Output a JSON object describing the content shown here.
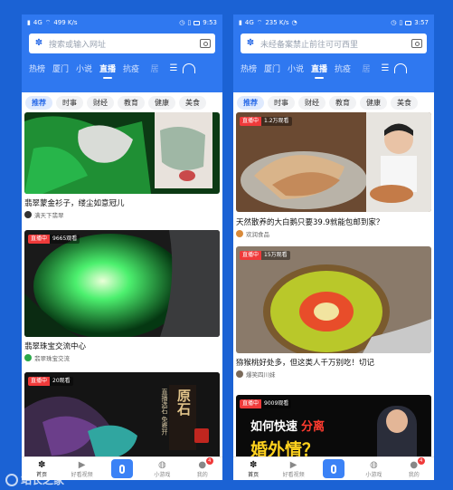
{
  "left": {
    "status": {
      "signal": "4G",
      "speed": "499 K/s",
      "time": "9:53"
    },
    "search_placeholder": "搜索或输入网址",
    "tabs": [
      "热榜",
      "厦门",
      "小说",
      "直播",
      "抗疫",
      "居"
    ],
    "subtabs": [
      "推荐",
      "时事",
      "财经",
      "教育",
      "健康",
      "美食"
    ],
    "cards": [
      {
        "title": "翡翠蒙金衫子，缕尘如意冠儿",
        "author": "满天下翡翠"
      },
      {
        "badge": "直播中",
        "viewers": "9665观看",
        "title": "翡翠珠宝交流中心",
        "author": "翡翠珠宝交流"
      },
      {
        "badge": "直播中",
        "viewers": "20观看",
        "poster_text": "原石",
        "poster_sub": "直播选石 免费开"
      }
    ],
    "nav": [
      "首页",
      "好看视频",
      "",
      "小游戏",
      "我的"
    ],
    "nav_badge": "4"
  },
  "right": {
    "status": {
      "signal": "4G",
      "speed": "235 K/s",
      "time": "3:57"
    },
    "search_placeholder": "未经备案禁止前往可可西里",
    "tabs": [
      "热榜",
      "厦门",
      "小说",
      "直播",
      "抗疫",
      "居"
    ],
    "subtabs": [
      "推荐",
      "时事",
      "财经",
      "教育",
      "健康",
      "美食"
    ],
    "cards": [
      {
        "badge": "直播中",
        "viewers": "1.2万观看",
        "title": "天然散养的大白鹅只要39.9就能包邮到家？",
        "author": "欢润食品"
      },
      {
        "badge": "直播中",
        "viewers": "15万观看",
        "title": "猕猴桃好处多，但这类人千万别吃！切记",
        "author": "爆笑四川妹"
      },
      {
        "badge": "直播中",
        "viewers": "9009观看",
        "poster_line1": "如何快速",
        "poster_hl": "分离",
        "poster_line2": "婚外情？"
      }
    ],
    "nav": [
      "首页",
      "好看视频",
      "",
      "小游戏",
      "我的"
    ],
    "nav_badge": "4"
  },
  "watermark": "站长之家",
  "colors": {
    "brand": "#2f78f0",
    "live": "#f03a3a",
    "jade": "#1fd35a"
  }
}
